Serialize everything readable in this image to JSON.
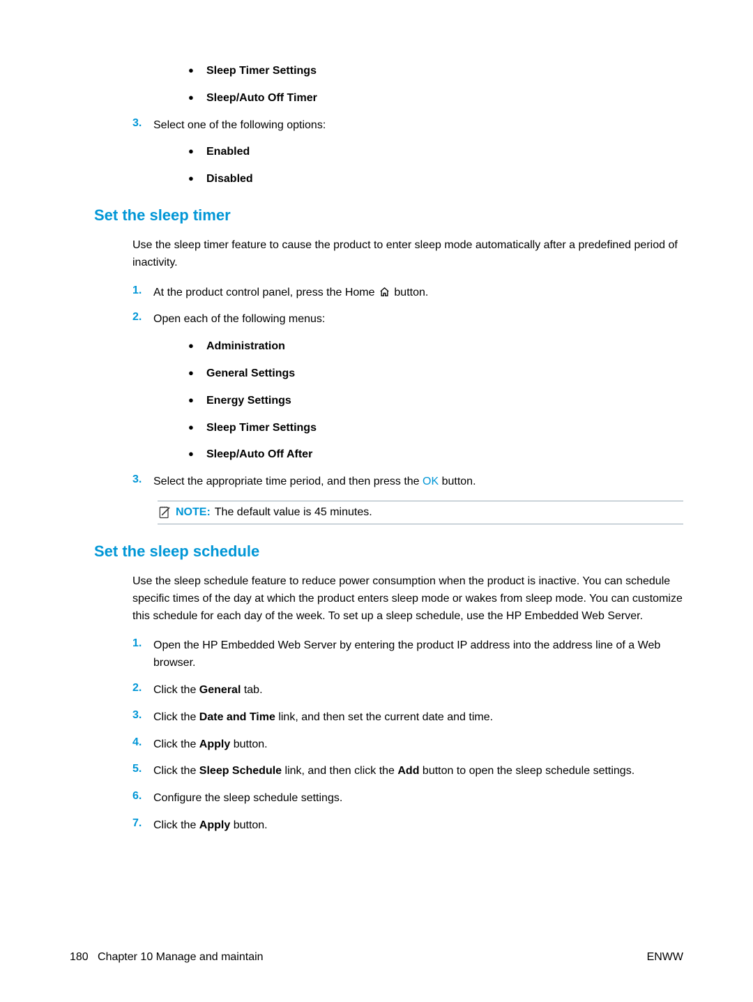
{
  "top_bullets": [
    "Sleep Timer Settings",
    "Sleep/Auto Off Timer"
  ],
  "top_step3": {
    "num": "3.",
    "text": "Select one of the following options:"
  },
  "top_step3_bullets": [
    "Enabled",
    "Disabled"
  ],
  "section1": {
    "heading": "Set the sleep timer",
    "intro": "Use the sleep timer feature to cause the product to enter sleep mode automatically after a predefined period of inactivity.",
    "step1": {
      "num": "1.",
      "pre": "At the product control panel, press the Home ",
      "post": " button."
    },
    "step2": {
      "num": "2.",
      "text": "Open each of the following menus:"
    },
    "step2_bullets": [
      "Administration",
      "General Settings",
      "Energy Settings",
      "Sleep Timer Settings",
      "Sleep/Auto Off After"
    ],
    "step3": {
      "num": "3.",
      "pre": "Select the appropriate time period, and then press the ",
      "ok": "OK",
      "post": " button."
    },
    "note": {
      "label": "NOTE:",
      "text": "The default value is 45 minutes."
    }
  },
  "section2": {
    "heading": "Set the sleep schedule",
    "intro": "Use the sleep schedule feature to reduce power consumption when the product is inactive. You can schedule specific times of the day at which the product enters sleep mode or wakes from sleep mode. You can customize this schedule for each day of the week. To set up a sleep schedule, use the HP Embedded Web Server.",
    "steps": [
      {
        "num": "1.",
        "parts": [
          {
            "t": "Open the HP Embedded Web Server by entering the product IP address into the address line of a Web browser."
          }
        ]
      },
      {
        "num": "2.",
        "parts": [
          {
            "t": "Click the "
          },
          {
            "b": "General"
          },
          {
            "t": " tab."
          }
        ]
      },
      {
        "num": "3.",
        "parts": [
          {
            "t": "Click the "
          },
          {
            "b": "Date and Time"
          },
          {
            "t": " link, and then set the current date and time."
          }
        ]
      },
      {
        "num": "4.",
        "parts": [
          {
            "t": "Click the "
          },
          {
            "b": "Apply"
          },
          {
            "t": " button."
          }
        ]
      },
      {
        "num": "5.",
        "parts": [
          {
            "t": "Click the "
          },
          {
            "b": "Sleep Schedule"
          },
          {
            "t": " link, and then click the "
          },
          {
            "b": "Add"
          },
          {
            "t": " button to open the sleep schedule settings."
          }
        ]
      },
      {
        "num": "6.",
        "parts": [
          {
            "t": "Configure the sleep schedule settings."
          }
        ]
      },
      {
        "num": "7.",
        "parts": [
          {
            "t": "Click the "
          },
          {
            "b": "Apply"
          },
          {
            "t": " button."
          }
        ]
      }
    ]
  },
  "footer": {
    "page": "180",
    "chapter": "Chapter 10   Manage and maintain",
    "right": "ENWW"
  }
}
